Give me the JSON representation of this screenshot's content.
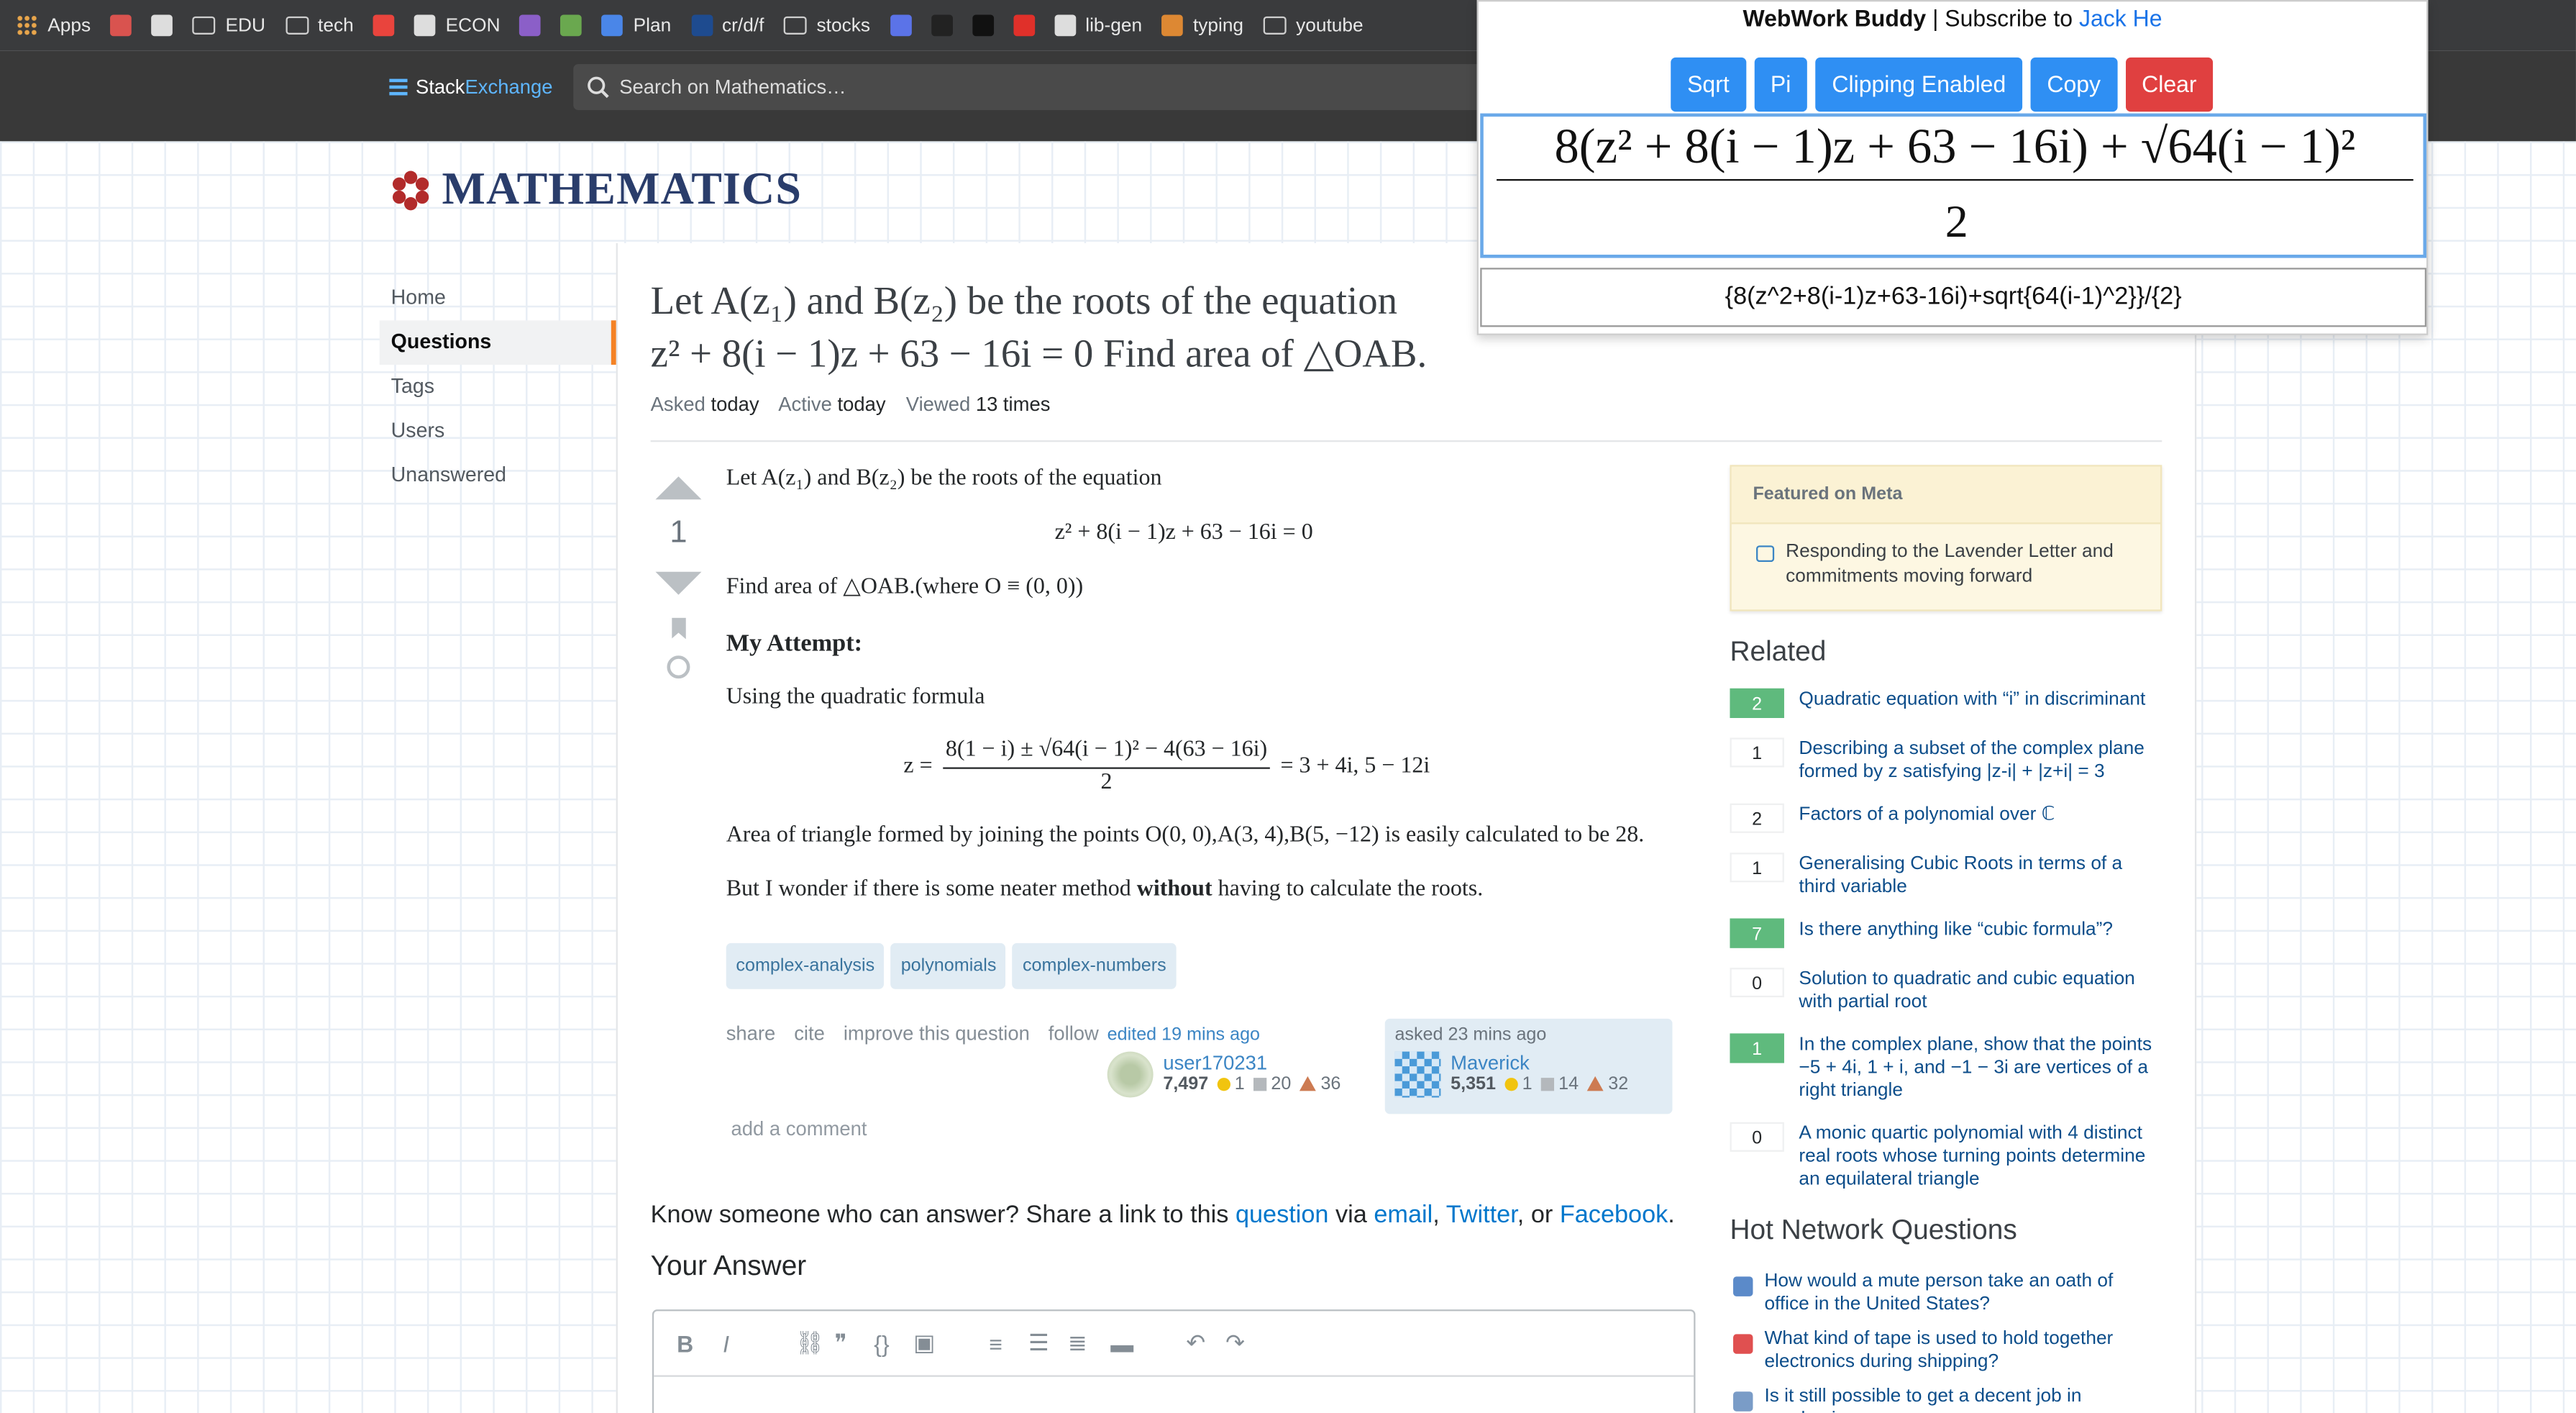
{
  "bookmarks": [
    {
      "label": "Apps",
      "icon": "apps-grid-icon",
      "color": "#e8a54b"
    },
    {
      "label": "",
      "icon": "exclamation-icon",
      "color": "#d9534f"
    },
    {
      "label": "",
      "icon": "github-icon",
      "color": "#dddddd"
    },
    {
      "label": "EDU",
      "icon": "folder-icon",
      "color": "#cfcfcf"
    },
    {
      "label": "tech",
      "icon": "folder-icon",
      "color": "#cfcfcf"
    },
    {
      "label": "",
      "icon": "red-site-icon",
      "color": "#e9443d"
    },
    {
      "label": "ECON",
      "icon": "globe-icon",
      "color": "#dddddd"
    },
    {
      "label": "",
      "icon": "peace-icon",
      "color": "#8b5fc8"
    },
    {
      "label": "",
      "icon": "px-icon",
      "color": "#6aa84f"
    },
    {
      "label": "Plan",
      "icon": "docs-icon",
      "color": "#4a86e8"
    },
    {
      "label": "cr/d/f",
      "icon": "ubc-icon",
      "color": "#1e4b8f"
    },
    {
      "label": "stocks",
      "icon": "folder-icon",
      "color": "#cfcfcf"
    },
    {
      "label": "",
      "icon": "c-circle-icon",
      "color": "#5b73e8"
    },
    {
      "label": "",
      "icon": "b-icon",
      "color": "#222222"
    },
    {
      "label": "",
      "icon": "k-icon",
      "color": "#111111"
    },
    {
      "label": "",
      "icon": "s-icon",
      "color": "#e0302a"
    },
    {
      "label": "lib-gen",
      "icon": "book-icon",
      "color": "#dddddd"
    },
    {
      "label": "typing",
      "icon": "ninja-icon",
      "color": "#dd8833"
    },
    {
      "label": "youtube",
      "icon": "folder-icon",
      "color": "#cfcfcf"
    }
  ],
  "header": {
    "logo_a": "Stack",
    "logo_b": "Exchange",
    "search_placeholder": "Search on Mathematics…"
  },
  "site": {
    "title": "MATHEMATICS",
    "nav": [
      "Home",
      "Questions",
      "Tags",
      "Users",
      "Unanswered"
    ]
  },
  "question": {
    "title_line1": "Let A(z₁) and B(z₂) be the roots of the equation",
    "title_line2": "z² + 8(i − 1)z + 63 − 16i = 0 Find area of △OAB.",
    "asked_label": "Asked",
    "asked": "today",
    "active_label": "Active",
    "active": "today",
    "viewed_label": "Viewed",
    "viewed": "13 times",
    "votes": "1",
    "body": {
      "p1": "Let A(z₁) and B(z₂) be the roots of the equation",
      "eq1": "z² + 8(i − 1)z + 63 − 16i = 0",
      "p2": "Find area of △OAB.(where O ≡ (0, 0))",
      "attempt": "My Attempt:",
      "p3": "Using the quadratic formula",
      "eq2_lhs": "z =",
      "eq2_num": "8(1 − i) ± √64(i − 1)² − 4(63 − 16i)",
      "eq2_den": "2",
      "eq2_rhs": "= 3 + 4i, 5 − 12i",
      "p4": "Area of triangle formed by joining the points O(0, 0),A(3, 4),B(5, −12) is easily calculated to be 28.",
      "p5_a": "But I wonder if there is some neater method ",
      "p5_b": "without",
      "p5_c": " having to calculate the roots."
    },
    "tags": [
      "complex-analysis",
      "polynomials",
      "complex-numbers"
    ],
    "actions": [
      "share",
      "cite",
      "improve this question",
      "follow"
    ],
    "edited": {
      "label": "edited 19 mins ago",
      "user": "user170231",
      "rep": "7,497",
      "gold": "1",
      "silver": "20",
      "bronze": "36"
    },
    "asked_card": {
      "label": "asked 23 mins ago",
      "user": "Maverick",
      "rep": "5,351",
      "gold": "1",
      "silver": "14",
      "bronze": "32"
    },
    "add_comment": "add a comment"
  },
  "sidebar": {
    "featured_header": "Featured on Meta",
    "featured_item": "Responding to the Lavender Letter and commitments moving forward",
    "related_header": "Related",
    "related": [
      {
        "count": "2",
        "answered": true,
        "text": "Quadratic equation with “i” in discriminant"
      },
      {
        "count": "1",
        "answered": false,
        "text": "Describing a subset of the complex plane formed by z satisfying |z-i| + |z+i| = 3"
      },
      {
        "count": "2",
        "answered": false,
        "text": "Factors of a polynomial over ℂ"
      },
      {
        "count": "1",
        "answered": false,
        "text": "Generalising Cubic Roots in terms of a third variable"
      },
      {
        "count": "7",
        "answered": true,
        "text": "Is there anything like “cubic formula”?"
      },
      {
        "count": "0",
        "answered": false,
        "text": "Solution to quadratic and cubic equation with partial root"
      },
      {
        "count": "1",
        "answered": true,
        "text": "In the complex plane, show that the points −5 + 4i, 1 + i, and −1 − 3i are vertices of a right triangle"
      },
      {
        "count": "0",
        "answered": false,
        "text": "A monic quartic polynomial with 4 distinct real roots whose turning points determine an equilateral triangle"
      }
    ],
    "hot_header": "Hot Network Questions",
    "hot": [
      {
        "text": "How would a mute person take an oath of office in the United States?",
        "color": "#5b8ac9"
      },
      {
        "text": "What kind of tape is used to hold together electronics during shipping?",
        "color": "#e05050"
      },
      {
        "text": "Is it still possible to get a decent job in academia",
        "color": "#7a9cc7"
      }
    ]
  },
  "share": {
    "prefix": "Know someone who can answer? Share a link to this ",
    "link_question": "question",
    "via": " via ",
    "email": "email",
    ", ": ", ",
    "twitter": "Twitter",
    "or": ", or ",
    "facebook": "Facebook",
    "end": "."
  },
  "your_answer": "Your Answer",
  "popup": {
    "title_bold": "WebWork Buddy",
    "title_sep": " | Subscribe to ",
    "title_link": "Jack He",
    "buttons": [
      "Sqrt",
      "Pi",
      "Clipping Enabled",
      "Copy",
      "Clear"
    ],
    "math_num": "8(z² + 8(i − 1)z + 63 − 16i) + √64(i − 1)²",
    "math_den": "2",
    "raw": "{8(z^2+8(i-1)z+63-16i)+sqrt{64(i-1)^2}}/{2}"
  },
  "colors": {
    "accent": "#f48225",
    "link": "#0077cc",
    "answered": "#5fba7d",
    "button": "#2f8ff3",
    "clear": "#e04040",
    "site_title": "#2a3d6b"
  }
}
